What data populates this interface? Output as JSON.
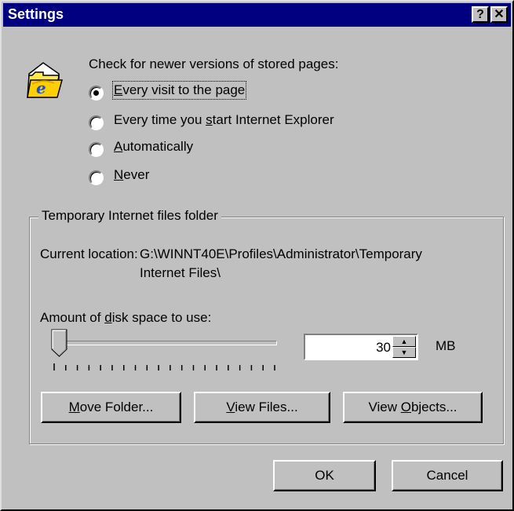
{
  "window": {
    "title": "Settings",
    "help_label": "?",
    "close_label": "✕"
  },
  "check": {
    "heading": "Check for newer versions of stored pages:",
    "icon": "ie-folder-icon",
    "options": [
      {
        "before": "",
        "mnemonic": "E",
        "after": "very visit to the page",
        "selected": true
      },
      {
        "before": "Every time you ",
        "mnemonic": "s",
        "after": "tart Internet Explorer",
        "selected": false
      },
      {
        "before": "",
        "mnemonic": "A",
        "after": "utomatically",
        "selected": false
      },
      {
        "before": "",
        "mnemonic": "N",
        "after": "ever",
        "selected": false
      }
    ]
  },
  "temp_folder": {
    "legend": "Temporary Internet files folder",
    "location_label": "Current location:",
    "location_line1": "G:\\WINNT40E\\Profiles\\Administrator\\Temporary",
    "location_line2": "Internet Files\\",
    "disk_label_before": "Amount of ",
    "disk_label_mnemonic": "d",
    "disk_label_after": "isk space to use:",
    "slider_fraction": 0.03,
    "size_value": "30",
    "size_unit": "MB",
    "buttons": [
      {
        "name": "move-folder-button",
        "before": "",
        "mnemonic": "M",
        "after": "ove Folder..."
      },
      {
        "name": "view-files-button",
        "before": "",
        "mnemonic": "V",
        "after": "iew Files..."
      },
      {
        "name": "view-objects-button",
        "before": "View ",
        "mnemonic": "O",
        "after": "bjects..."
      }
    ]
  },
  "footer": {
    "ok_label": "OK",
    "cancel_label": "Cancel"
  }
}
